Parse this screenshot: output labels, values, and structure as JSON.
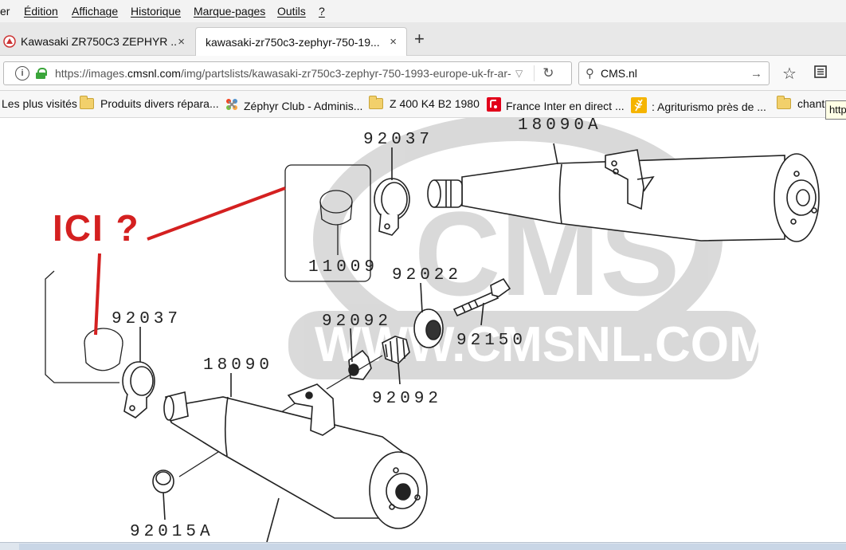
{
  "menu": {
    "items": [
      "er",
      "Édition",
      "Affichage",
      "Historique",
      "Marque-pages",
      "Outils",
      "?"
    ]
  },
  "tabs": [
    {
      "title": "Kawasaki ZR750C3 ZEPHYR ...",
      "close": "×",
      "active": false
    },
    {
      "title": "kawasaki-zr750c3-zephyr-750-19...",
      "close": "×",
      "active": true
    }
  ],
  "newtab": "+",
  "nav": {
    "url_prefix": "https://images.",
    "url_domain": "cmsnl.com",
    "url_rest": "/img/partslists/kawasaki-zr750c3-zephyr-750-1993-europe-uk-fr-ar-",
    "search_value": "CMS.nl"
  },
  "bookmarks": [
    {
      "label": "Les plus visités",
      "icon": "none"
    },
    {
      "label": "Produits divers répara...",
      "icon": "folder-icon"
    },
    {
      "label": "Zéphyr Club - Adminis...",
      "icon": "joomla-icon"
    },
    {
      "label": "Z 400 K4 B2 1980",
      "icon": "folder-icon"
    },
    {
      "label": "France Inter en direct ...",
      "icon": "radio-icon"
    },
    {
      "label": ": Agriturismo près de ...",
      "icon": "wheat-icon"
    },
    {
      "label": "chant",
      "icon": "folder-icon"
    }
  ],
  "tooltip": "http",
  "diagram": {
    "annotation": "ICI ?",
    "annotation_color": "#d42020",
    "parts": {
      "p18090A": "18090A",
      "p92037_top": "92037",
      "p11009": "11009",
      "p92022": "92022",
      "p92150": "92150",
      "p92092_a": "92092",
      "p92092_b": "92092",
      "p92037_left": "92037",
      "p18090": "18090",
      "p92015A": "92015A"
    },
    "watermark_logo": "CMS",
    "watermark_url": "WWW.CMSNL.COM"
  }
}
